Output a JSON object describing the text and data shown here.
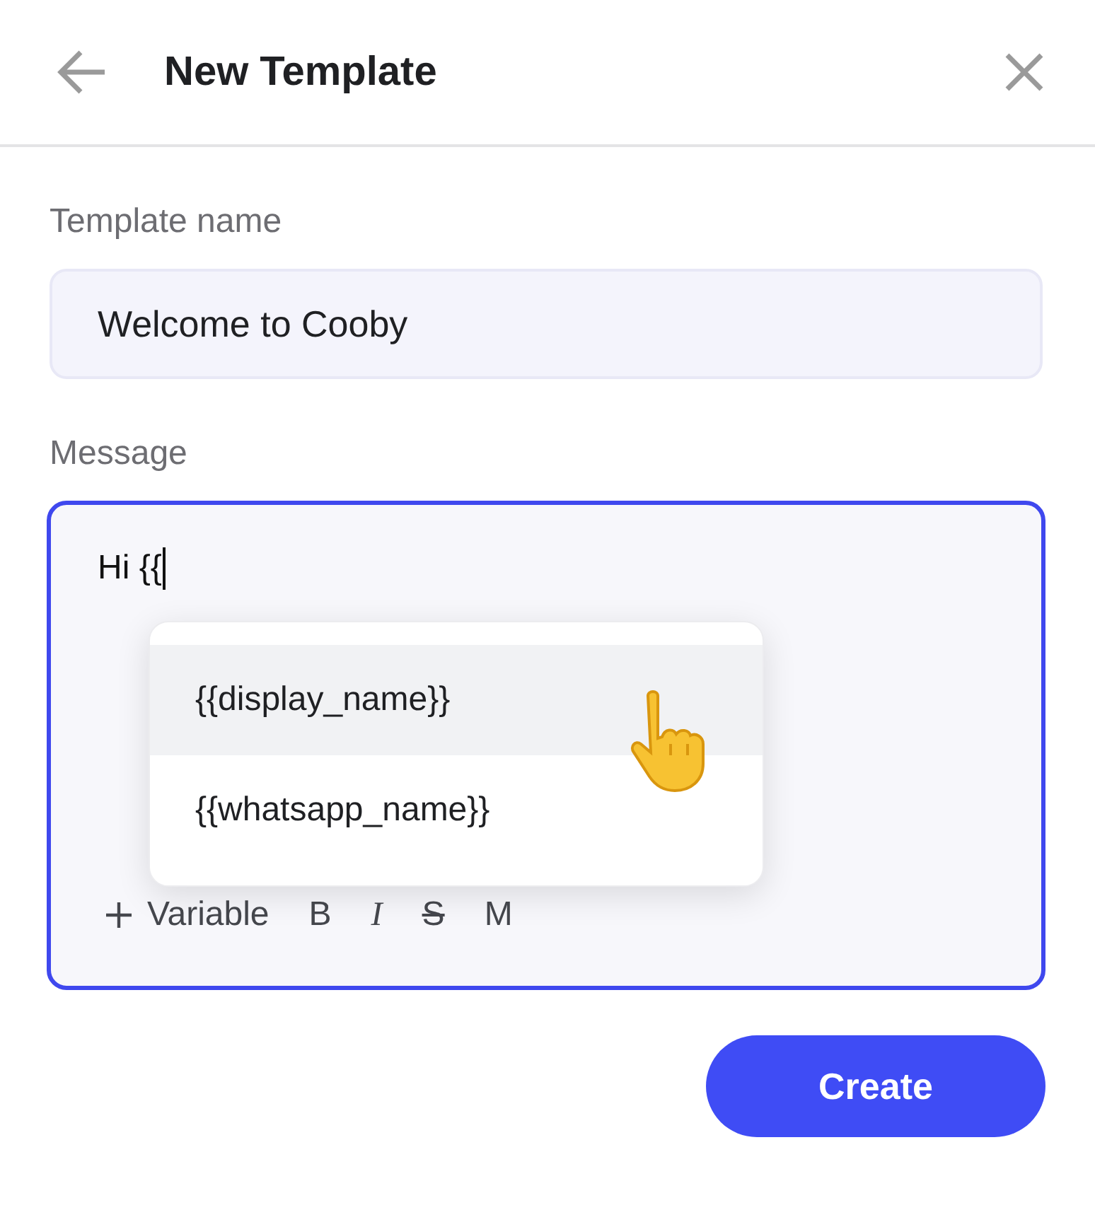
{
  "header": {
    "title": "New Template"
  },
  "template_name": {
    "label": "Template name",
    "value": "Welcome to Cooby"
  },
  "message": {
    "label": "Message",
    "value": "Hi {{",
    "variable_menu": [
      {
        "label": "{{display_name}}",
        "selected": true
      },
      {
        "label": "{{whatsapp_name}}",
        "selected": false
      }
    ],
    "toolbar": [
      {
        "kind": "add",
        "label": "Variable"
      },
      {
        "kind": "bold",
        "label": "B"
      },
      {
        "kind": "italic",
        "label": "I"
      },
      {
        "kind": "strike",
        "label": "S"
      },
      {
        "kind": "mono",
        "label": "M"
      }
    ]
  },
  "create_button": {
    "label": "Create"
  }
}
